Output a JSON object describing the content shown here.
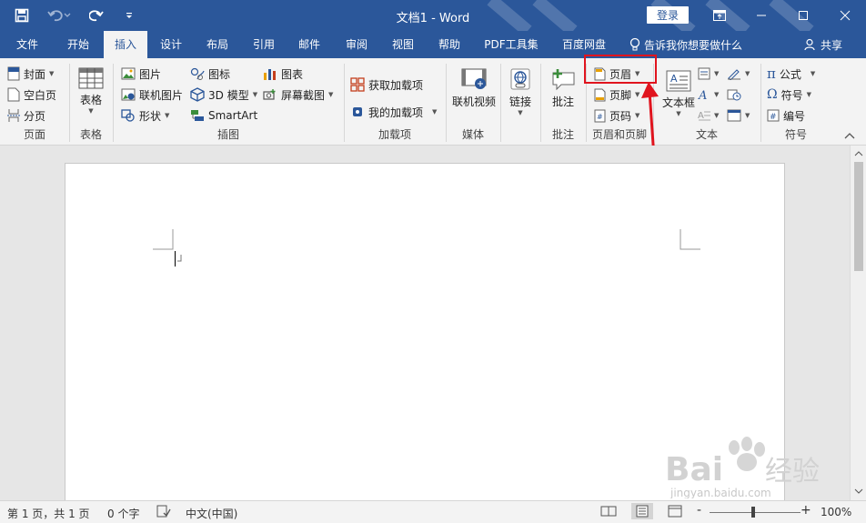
{
  "app": {
    "title": "文档1  -  Word",
    "login": "登录"
  },
  "tabs": [
    "文件",
    "开始",
    "插入",
    "设计",
    "布局",
    "引用",
    "邮件",
    "审阅",
    "视图",
    "帮助",
    "PDF工具集",
    "百度网盘"
  ],
  "active_tab": "插入",
  "tell_me": "告诉我你想要做什么",
  "share": "共享",
  "ribbon": {
    "pages": {
      "cover": "封面",
      "blank": "空白页",
      "break": "分页",
      "label": "页面"
    },
    "tables": {
      "table": "表格",
      "label": "表格"
    },
    "illustrations": {
      "picture": "图片",
      "online_picture": "联机图片",
      "shapes": "形状",
      "icons": "图标",
      "model3d": "3D 模型",
      "smartart": "SmartArt",
      "chart": "图表",
      "screenshot": "屏幕截图",
      "label": "插图"
    },
    "addins": {
      "get": "获取加载项",
      "my": "我的加载项",
      "label": "加载项"
    },
    "media": {
      "online_video": "联机视频",
      "label": "媒体"
    },
    "links": {
      "link": "链接"
    },
    "comments": {
      "comment": "批注",
      "label": "批注"
    },
    "header_footer": {
      "header": "页眉",
      "footer": "页脚",
      "page_number": "页码",
      "label": "页眉和页脚"
    },
    "text": {
      "textbox": "文本框",
      "label": "文本"
    },
    "symbols": {
      "equation": "公式",
      "symbol": "符号",
      "number": "编号",
      "label": "符号"
    }
  },
  "status": {
    "page": "第 1 页，共 1 页",
    "words": "0 个字",
    "language": "中文(中国)",
    "zoom": "100%",
    "zoom_minus": "-",
    "zoom_plus": "+"
  },
  "watermark": {
    "brand": "Bai",
    "brand2": "经验",
    "url": "jingyan.baidu.com"
  },
  "colors": {
    "accent": "#2b579a",
    "highlight": "#e0141e"
  }
}
